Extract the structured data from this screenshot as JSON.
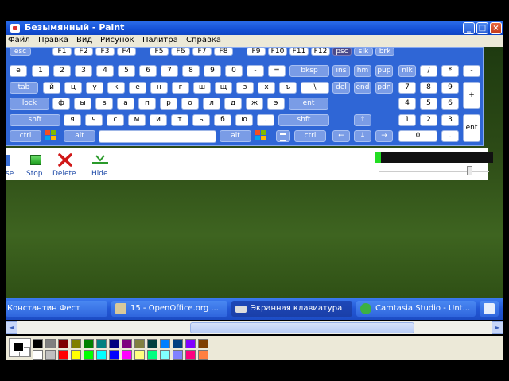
{
  "window": {
    "title": "Безымянный - Paint",
    "btn_min": "_",
    "btn_max": "□",
    "btn_close": "×"
  },
  "menu": [
    "Файл",
    "Правка",
    "Вид",
    "Рисунок",
    "Палитра",
    "Справка"
  ],
  "keyboard": {
    "rows": [
      [
        "esc",
        "F1",
        "F2",
        "F3",
        "F4",
        "F5",
        "F6",
        "F7",
        "F8",
        "F9",
        "F10",
        "F11",
        "F12",
        "psc",
        "slk",
        "brk"
      ],
      [
        "ё",
        "1",
        "2",
        "3",
        "4",
        "5",
        "6",
        "7",
        "8",
        "9",
        "0",
        "-",
        "=",
        "bksp",
        "ins",
        "hm",
        "pup",
        "nlk",
        "/",
        "*",
        "-"
      ],
      [
        "tab",
        "й",
        "ц",
        "у",
        "к",
        "е",
        "н",
        "г",
        "ш",
        "щ",
        "з",
        "х",
        "ъ",
        "\\",
        "del",
        "end",
        "pdn",
        "7",
        "8",
        "9",
        "+"
      ],
      [
        "lock",
        "ф",
        "ы",
        "в",
        "а",
        "п",
        "р",
        "о",
        "л",
        "д",
        "ж",
        "э",
        "ent",
        "4",
        "5",
        "6"
      ],
      [
        "shft",
        "я",
        "ч",
        "с",
        "м",
        "и",
        "т",
        "ь",
        "б",
        "ю",
        ".",
        "shft",
        "1",
        "2",
        "3"
      ],
      [
        "ctrl",
        "alt",
        "alt",
        "ctrl",
        "0",
        ".",
        "ent"
      ]
    ],
    "arrow_up": "↑",
    "arrow_left": "←",
    "arrow_down": "↓",
    "arrow_right": "→"
  },
  "recorder": {
    "buttons": [
      "se",
      "Stop",
      "Delete",
      "Hide"
    ],
    "level": 0.05,
    "volume": 0.82,
    "colors": {
      "meter_on": "#22dd22",
      "meter_bg": "#111111"
    }
  },
  "taskbar": {
    "items": [
      {
        "label": "Константин Фест",
        "icon": "user-icon"
      },
      {
        "label": "15 - OpenOffice.org ...",
        "icon": "openoffice-icon"
      },
      {
        "label": "Экранная клавиатура",
        "icon": "keyboard-icon"
      },
      {
        "label": "Camtasia Studio - Unt...",
        "icon": "camtasia-icon"
      }
    ]
  },
  "scrollbar": {
    "left": "◄",
    "right": "►"
  },
  "palette": {
    "top": [
      "#000000",
      "#808080",
      "#800000",
      "#808000",
      "#008000",
      "#008080",
      "#000080",
      "#800080",
      "#808040",
      "#004040",
      "#0080ff",
      "#004080",
      "#8000ff",
      "#804000"
    ],
    "bottom": [
      "#ffffff",
      "#c0c0c0",
      "#ff0000",
      "#ffff00",
      "#00ff00",
      "#00ffff",
      "#0000ff",
      "#ff00ff",
      "#ffff80",
      "#00ff80",
      "#80ffff",
      "#8080ff",
      "#ff0080",
      "#ff8040"
    ]
  }
}
